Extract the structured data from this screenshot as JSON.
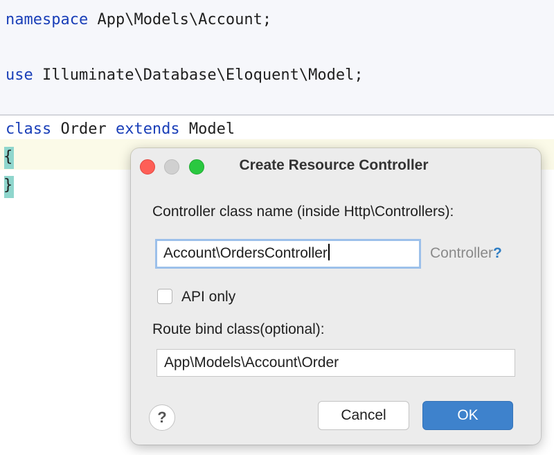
{
  "editor": {
    "line1": {
      "keyword": "namespace",
      "rest": " App\\Models\\Account;"
    },
    "line2": {
      "keyword": "use",
      "rest": " Illuminate\\Database\\Eloquent\\Model;"
    },
    "line3": {
      "kw_class": "class",
      "name": " Order ",
      "kw_extends": "extends",
      "parent": " Model"
    },
    "open_brace": "{",
    "close_brace": "}"
  },
  "dialog": {
    "title": "Create Resource Controller",
    "class_name_label": "Controller class name (inside Http\\Controllers):",
    "class_name_value": "Account\\OrdersController",
    "suffix_text": "Controller",
    "suffix_help": "?",
    "api_only_label": "API only",
    "api_only_checked": false,
    "route_bind_label": "Route bind class(optional):",
    "route_bind_value": "App\\Models\\Account\\Order",
    "help_symbol": "?",
    "cancel_label": "Cancel",
    "ok_label": "OK"
  }
}
